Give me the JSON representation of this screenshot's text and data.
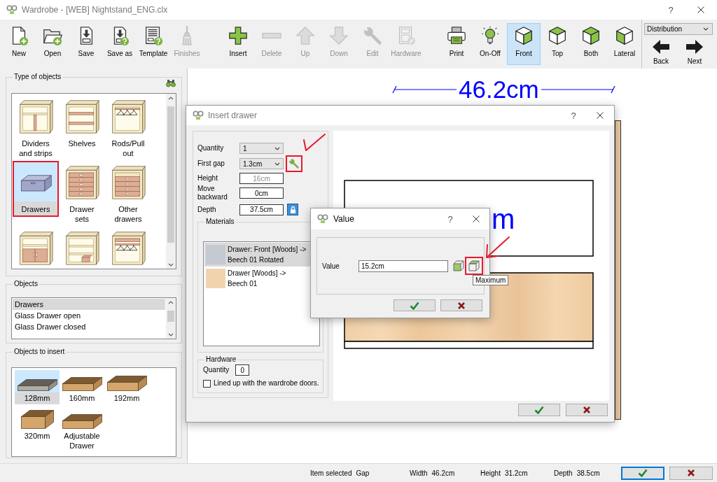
{
  "window": {
    "title": "Wardrobe - [WEB] Nightstand_ENG.clx",
    "active": false,
    "help": "?"
  },
  "toolbar": {
    "file_tools": [
      {
        "label": "New",
        "disabled": false
      },
      {
        "label": "Open",
        "disabled": false
      },
      {
        "label": "Save",
        "disabled": false
      },
      {
        "label": "Save as",
        "disabled": false
      },
      {
        "label": "Template",
        "disabled": false
      },
      {
        "label": "Finishes",
        "disabled": true
      }
    ],
    "edit_tools": [
      {
        "label": "Insert",
        "disabled": false
      },
      {
        "label": "Delete",
        "disabled": true
      },
      {
        "label": "Up",
        "disabled": true
      },
      {
        "label": "Down",
        "disabled": true
      },
      {
        "label": "Edit",
        "disabled": true
      },
      {
        "label": "Hardware",
        "disabled": true
      }
    ],
    "view_tools": [
      {
        "label": "Print",
        "selected": false
      },
      {
        "label": "On-Off",
        "selected": false
      },
      {
        "label": "Front",
        "selected": true
      },
      {
        "label": "Top",
        "selected": false
      },
      {
        "label": "Both",
        "selected": false
      },
      {
        "label": "Lateral",
        "selected": false
      }
    ],
    "view_selector": "Distribution",
    "navigation": [
      {
        "label": "Back"
      },
      {
        "label": "Next"
      }
    ]
  },
  "type_of_objects": {
    "title": "Type of objects",
    "items": [
      {
        "label": "Dividers and strips",
        "selected": false,
        "highlighted": false
      },
      {
        "label": "Shelves",
        "selected": false,
        "highlighted": false
      },
      {
        "label": "Rods/Pull out",
        "selected": false,
        "highlighted": false
      },
      {
        "label": "Drawers",
        "selected": true,
        "highlighted": true
      },
      {
        "label": "Drawer sets",
        "selected": false,
        "highlighted": false
      },
      {
        "label": "Other drawers",
        "selected": false,
        "highlighted": false
      },
      {
        "selected": false,
        "highlighted": false
      },
      {
        "selected": false,
        "highlighted": false
      },
      {
        "selected": false,
        "highlighted": false
      }
    ]
  },
  "objects": {
    "title": "Objects",
    "items": [
      {
        "label": "Drawers",
        "selected": true
      },
      {
        "label": "Glass Drawer open",
        "selected": false
      },
      {
        "label": "Glass Drawer closed",
        "selected": false
      }
    ]
  },
  "objects_to_insert": {
    "title": "Objects to insert",
    "items": [
      {
        "label": "128mm",
        "selected": true
      },
      {
        "label": "160mm",
        "selected": false
      },
      {
        "label": "192mm",
        "selected": false
      },
      {
        "label": "320mm",
        "selected": false
      },
      {
        "label": "Adjustable Drawer",
        "selected": false
      }
    ]
  },
  "canvas": {
    "width_dimension": "46.2cm"
  },
  "insert_drawer_dialog": {
    "title": "Insert drawer",
    "active": false,
    "help": "?",
    "fields": [
      {
        "label": "Quantity",
        "kind": "dropdown",
        "value": "1",
        "disabled": false
      },
      {
        "label": "First gap",
        "kind": "dropdown",
        "value": "1.3cm",
        "disabled": false,
        "tool_button": {
          "highlighted": true
        }
      },
      {
        "label": "Height",
        "kind": "input",
        "value": "16cm",
        "disabled": true
      },
      {
        "label": "Move backward",
        "kind": "input",
        "value": "0cm",
        "disabled": false
      },
      {
        "label": "Depth",
        "kind": "input",
        "value": "37.5cm",
        "disabled": false,
        "lock_button": {
          "locked": true
        }
      }
    ],
    "materials": {
      "title": "Materials",
      "items": [
        {
          "lines": [
            "Drawer: Front [Woods] ->",
            "Beech 01 Rotated"
          ],
          "color": "#c5cad1",
          "selected": true
        },
        {
          "lines": [
            "Drawer [Woods] ->",
            "Beech 01"
          ],
          "color": "#f2d3b0",
          "selected": false
        }
      ]
    },
    "hardware": {
      "title": "Hardware",
      "quantity_label": "Quantity",
      "quantity": "0",
      "checkbox": {
        "label": "Lined up with the wardrobe doors.",
        "checked": false
      }
    },
    "preview": {
      "dimension_fragment": "m"
    }
  },
  "value_dialog": {
    "title": "Value",
    "active": true,
    "help": "?",
    "label": "Value",
    "value": "15.2cm",
    "size_buttons": [
      {
        "highlighted": false
      },
      {
        "highlighted": true,
        "tooltip": "Maximum"
      }
    ]
  },
  "status_bar": {
    "fields": [
      {
        "label": "Item selected",
        "value": "Gap"
      },
      {
        "label": "Width",
        "value": "46.2cm"
      },
      {
        "label": "Height",
        "value": "31.2cm"
      },
      {
        "label": "Depth",
        "value": "38.5cm"
      }
    ]
  }
}
